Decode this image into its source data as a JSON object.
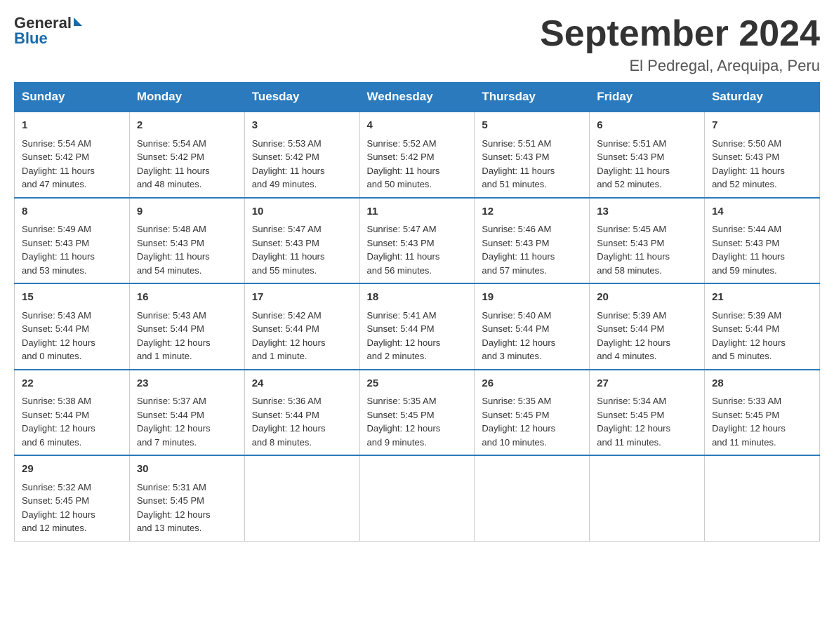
{
  "header": {
    "logo_general": "General",
    "logo_blue": "Blue",
    "title": "September 2024",
    "subtitle": "El Pedregal, Arequipa, Peru"
  },
  "days_of_week": [
    "Sunday",
    "Monday",
    "Tuesday",
    "Wednesday",
    "Thursday",
    "Friday",
    "Saturday"
  ],
  "weeks": [
    [
      {
        "day": "1",
        "sunrise": "5:54 AM",
        "sunset": "5:42 PM",
        "daylight": "11 hours and 47 minutes."
      },
      {
        "day": "2",
        "sunrise": "5:54 AM",
        "sunset": "5:42 PM",
        "daylight": "11 hours and 48 minutes."
      },
      {
        "day": "3",
        "sunrise": "5:53 AM",
        "sunset": "5:42 PM",
        "daylight": "11 hours and 49 minutes."
      },
      {
        "day": "4",
        "sunrise": "5:52 AM",
        "sunset": "5:42 PM",
        "daylight": "11 hours and 50 minutes."
      },
      {
        "day": "5",
        "sunrise": "5:51 AM",
        "sunset": "5:43 PM",
        "daylight": "11 hours and 51 minutes."
      },
      {
        "day": "6",
        "sunrise": "5:51 AM",
        "sunset": "5:43 PM",
        "daylight": "11 hours and 52 minutes."
      },
      {
        "day": "7",
        "sunrise": "5:50 AM",
        "sunset": "5:43 PM",
        "daylight": "11 hours and 52 minutes."
      }
    ],
    [
      {
        "day": "8",
        "sunrise": "5:49 AM",
        "sunset": "5:43 PM",
        "daylight": "11 hours and 53 minutes."
      },
      {
        "day": "9",
        "sunrise": "5:48 AM",
        "sunset": "5:43 PM",
        "daylight": "11 hours and 54 minutes."
      },
      {
        "day": "10",
        "sunrise": "5:47 AM",
        "sunset": "5:43 PM",
        "daylight": "11 hours and 55 minutes."
      },
      {
        "day": "11",
        "sunrise": "5:47 AM",
        "sunset": "5:43 PM",
        "daylight": "11 hours and 56 minutes."
      },
      {
        "day": "12",
        "sunrise": "5:46 AM",
        "sunset": "5:43 PM",
        "daylight": "11 hours and 57 minutes."
      },
      {
        "day": "13",
        "sunrise": "5:45 AM",
        "sunset": "5:43 PM",
        "daylight": "11 hours and 58 minutes."
      },
      {
        "day": "14",
        "sunrise": "5:44 AM",
        "sunset": "5:43 PM",
        "daylight": "11 hours and 59 minutes."
      }
    ],
    [
      {
        "day": "15",
        "sunrise": "5:43 AM",
        "sunset": "5:44 PM",
        "daylight": "12 hours and 0 minutes."
      },
      {
        "day": "16",
        "sunrise": "5:43 AM",
        "sunset": "5:44 PM",
        "daylight": "12 hours and 1 minute."
      },
      {
        "day": "17",
        "sunrise": "5:42 AM",
        "sunset": "5:44 PM",
        "daylight": "12 hours and 1 minute."
      },
      {
        "day": "18",
        "sunrise": "5:41 AM",
        "sunset": "5:44 PM",
        "daylight": "12 hours and 2 minutes."
      },
      {
        "day": "19",
        "sunrise": "5:40 AM",
        "sunset": "5:44 PM",
        "daylight": "12 hours and 3 minutes."
      },
      {
        "day": "20",
        "sunrise": "5:39 AM",
        "sunset": "5:44 PM",
        "daylight": "12 hours and 4 minutes."
      },
      {
        "day": "21",
        "sunrise": "5:39 AM",
        "sunset": "5:44 PM",
        "daylight": "12 hours and 5 minutes."
      }
    ],
    [
      {
        "day": "22",
        "sunrise": "5:38 AM",
        "sunset": "5:44 PM",
        "daylight": "12 hours and 6 minutes."
      },
      {
        "day": "23",
        "sunrise": "5:37 AM",
        "sunset": "5:44 PM",
        "daylight": "12 hours and 7 minutes."
      },
      {
        "day": "24",
        "sunrise": "5:36 AM",
        "sunset": "5:44 PM",
        "daylight": "12 hours and 8 minutes."
      },
      {
        "day": "25",
        "sunrise": "5:35 AM",
        "sunset": "5:45 PM",
        "daylight": "12 hours and 9 minutes."
      },
      {
        "day": "26",
        "sunrise": "5:35 AM",
        "sunset": "5:45 PM",
        "daylight": "12 hours and 10 minutes."
      },
      {
        "day": "27",
        "sunrise": "5:34 AM",
        "sunset": "5:45 PM",
        "daylight": "12 hours and 11 minutes."
      },
      {
        "day": "28",
        "sunrise": "5:33 AM",
        "sunset": "5:45 PM",
        "daylight": "12 hours and 11 minutes."
      }
    ],
    [
      {
        "day": "29",
        "sunrise": "5:32 AM",
        "sunset": "5:45 PM",
        "daylight": "12 hours and 12 minutes."
      },
      {
        "day": "30",
        "sunrise": "5:31 AM",
        "sunset": "5:45 PM",
        "daylight": "12 hours and 13 minutes."
      },
      null,
      null,
      null,
      null,
      null
    ]
  ],
  "labels": {
    "sunrise": "Sunrise:",
    "sunset": "Sunset:",
    "daylight": "Daylight:"
  }
}
